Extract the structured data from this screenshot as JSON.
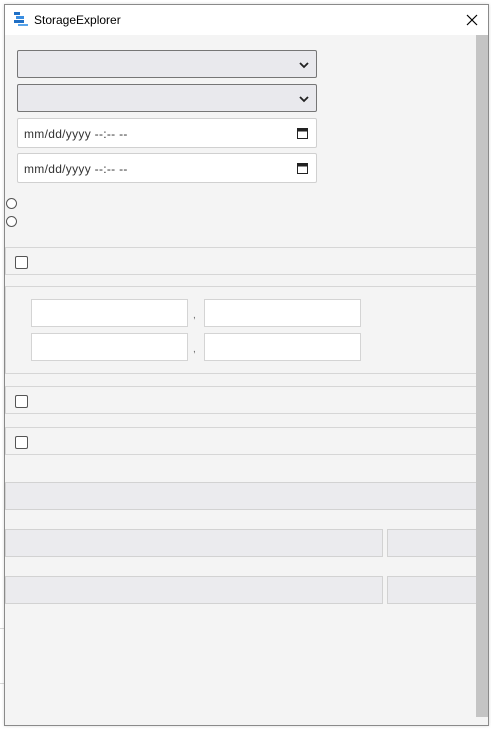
{
  "window": {
    "title": "StorageExplorer",
    "close_glyph": "✕",
    "app_icon": "storage-explorer-icon",
    "close_icon": "close-icon"
  },
  "filters": {
    "select_1_value": "",
    "select_2_value": "",
    "datetime_1_placeholder": "mm/dd/yyyy --:-- --",
    "datetime_2_placeholder": "mm/dd/yyyy --:-- --",
    "range_separator": ","
  },
  "colors": {
    "accent_icon_blue": "#1f6fc5",
    "window_bg": "#f4f4f4",
    "scrollbar": "#c4c4c4"
  }
}
